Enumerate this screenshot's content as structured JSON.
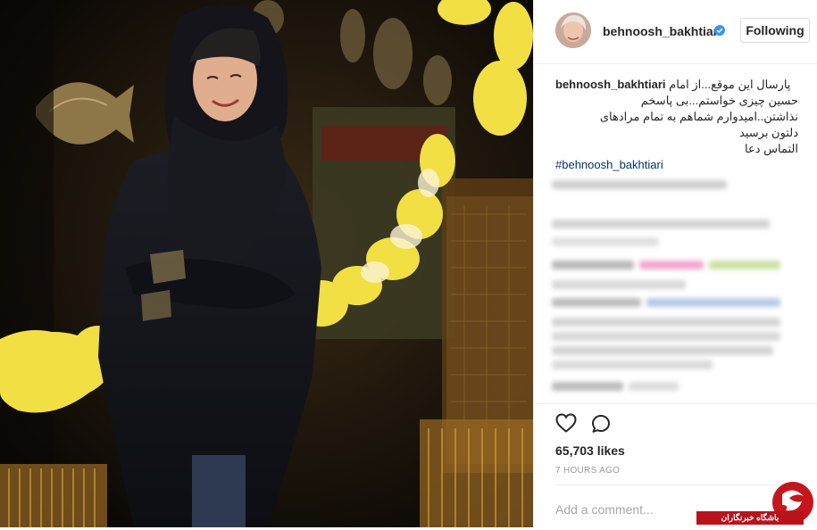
{
  "post": {
    "author": "behnoosh_bakhtiari",
    "follow_label": "Following",
    "caption": {
      "author": "behnoosh_bakhtiari",
      "line1": "پارسال این موقع...از امام",
      "line2": "حسین چیزی خواستم...بی پاسخم",
      "line3": "نذاشتن..امیدوارم شماهم به تمام مرادهای",
      "line4": "دلتون برسید",
      "line5": "التماس دعا",
      "hashtag": "#behnoosh_bakhtiari"
    },
    "likes": "65,703 likes",
    "time": "7 HOURS AGO",
    "comment_placeholder": "Add a comment..."
  },
  "icons": {
    "verified": "verified-badge-icon",
    "like": "heart-icon",
    "comment": "comment-bubble-icon"
  },
  "watermark": {
    "text": "باشگاه خبرنگاران"
  },
  "colors": {
    "text": "#262626",
    "link": "#003569",
    "muted": "#999999",
    "verified": "#3897f0",
    "watermark": "#b8131b"
  }
}
